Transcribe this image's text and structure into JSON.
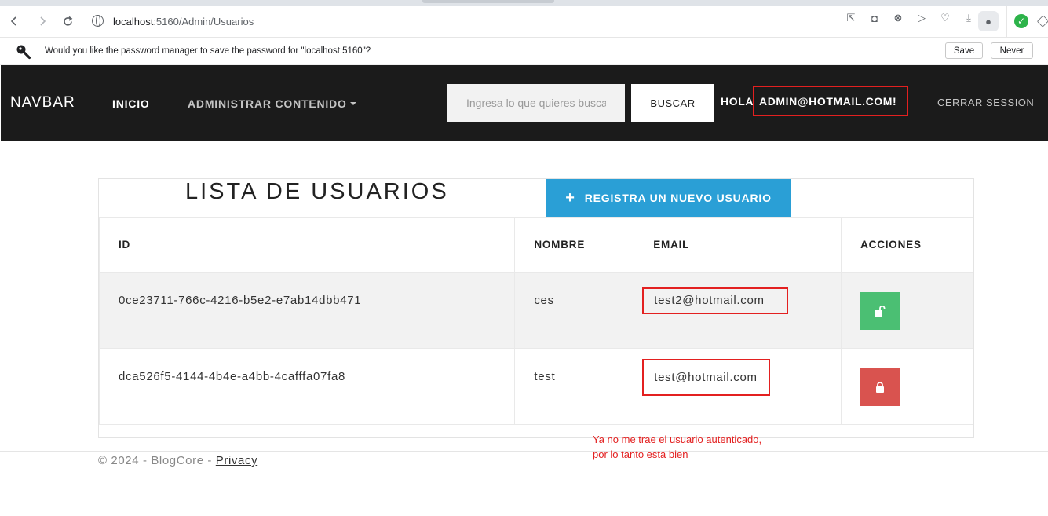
{
  "browser": {
    "url_host": "localhost",
    "url_rest": ":5160/Admin/Usuarios"
  },
  "password_bar": {
    "message": "Would you like the password manager to save the password for \"localhost:5160\"?",
    "save_label": "Save",
    "never_label": "Never"
  },
  "navbar": {
    "brand": "NAVBAR",
    "inicio": "INICIO",
    "admin": "ADMINISTRAR CONTENIDO",
    "search_placeholder": "Ingresa lo que quieres buscar",
    "search_button": "BUSCAR",
    "hola": "HOLA",
    "user": "ADMIN@HOTMAIL.COM!",
    "logout": "CERRAR SESSION"
  },
  "main": {
    "title": "LISTA DE USUARIOS",
    "add_button": "REGISTRA UN NUEVO USUARIO",
    "columns": [
      "ID",
      "NOMBRE",
      "EMAIL",
      "ACCIONES"
    ],
    "rows": [
      {
        "id": "0ce23711-766c-4216-b5e2-e7ab14dbb471",
        "nombre": "ces",
        "email": "test2@hotmail.com",
        "action": "unlock"
      },
      {
        "id": "dca526f5-4144-4b4e-a4bb-4cafffa07fa8",
        "nombre": "test",
        "email": "test@hotmail.com",
        "action": "lock"
      }
    ]
  },
  "footer": {
    "copyright": "© 2024 - BlogCore - ",
    "privacy": "Privacy"
  },
  "annotation": {
    "line1": "Ya no me trae el usuario autenticado,",
    "line2": "por lo tanto esta bien"
  },
  "colors": {
    "navbar_bg": "#1b1b1b",
    "primary": "#2a9fd6",
    "success": "#4bbf73",
    "danger": "#d9534f",
    "highlight": "#e32020"
  },
  "icons": [
    "back-icon",
    "forward-icon",
    "reload-icon",
    "globe-icon",
    "key-icon",
    "plus-icon",
    "unlock-icon",
    "lock-icon"
  ]
}
